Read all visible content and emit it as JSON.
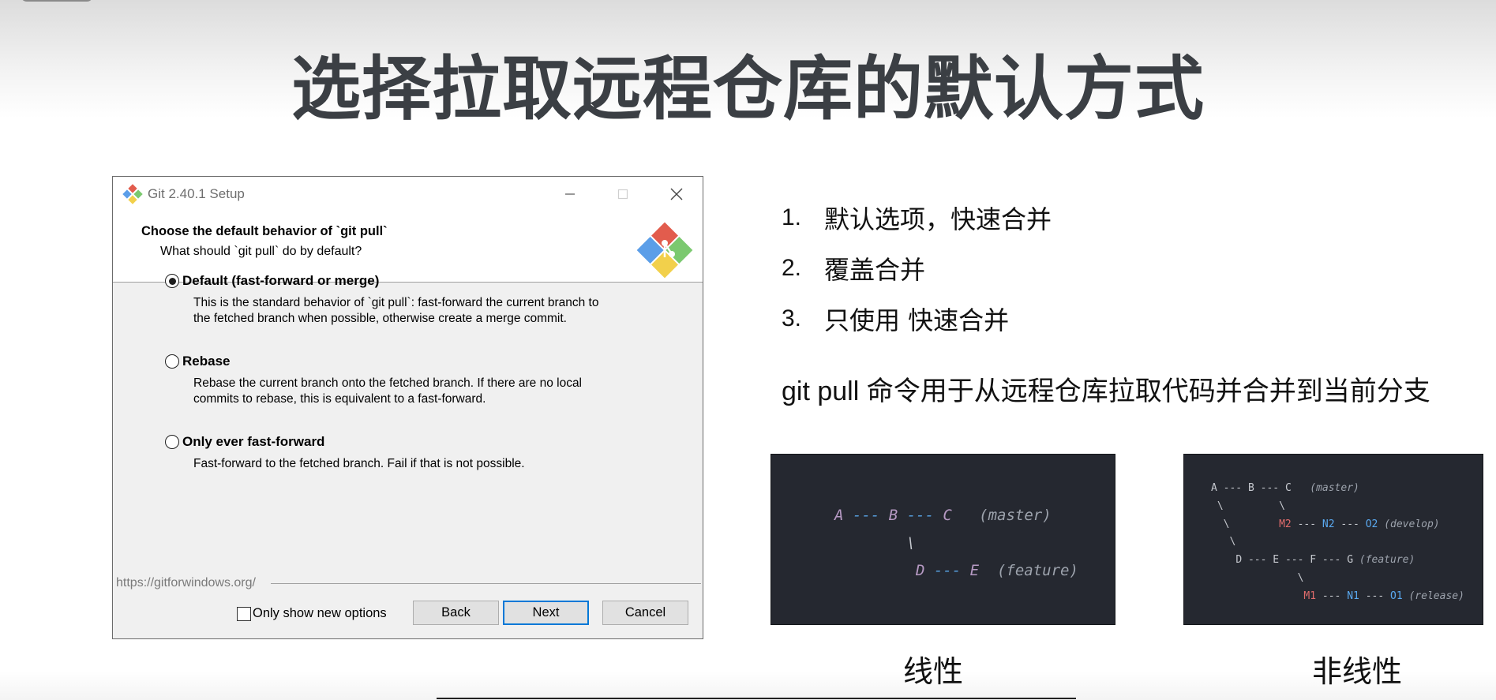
{
  "slide": {
    "title": "选择拉取远程仓库的默认方式"
  },
  "dialog": {
    "window_title": "Git 2.40.1 Setup",
    "header_title": "Choose the default behavior of `git pull`",
    "header_subtitle": "What should `git pull` do by default?",
    "options": [
      {
        "label": "Default (fast-forward or merge)",
        "description": "This is the standard behavior of `git pull`: fast-forward the current branch to\nthe fetched branch when possible, otherwise create a merge commit.",
        "selected": true
      },
      {
        "label": "Rebase",
        "description": "Rebase the current branch onto the fetched branch. If there are no local\ncommits to rebase, this is equivalent to a fast-forward.",
        "selected": false
      },
      {
        "label": "Only ever fast-forward",
        "description": "Fast-forward to the fetched branch. Fail if that is not possible.",
        "selected": false
      }
    ],
    "footer_url": "https://gitforwindows.org/",
    "only_new_options_label": "Only show new options",
    "buttons": {
      "back": "Back",
      "next": "Next",
      "cancel": "Cancel"
    },
    "icons": [
      "git-app-icon",
      "minimize-icon",
      "maximize-icon",
      "close-icon",
      "git-logo-icon"
    ]
  },
  "notes": {
    "points": [
      {
        "num": "1.",
        "text": "默认选项，快速合并"
      },
      {
        "num": "2.",
        "text": "覆盖合并"
      },
      {
        "num": "3.",
        "text": "只使用 快速合并"
      }
    ],
    "description": "git pull 命令用于从远程仓库拉取代码并合并到当前分支"
  },
  "diagrams": {
    "linear": {
      "line1": {
        "a": "A",
        "d1": "---",
        "b": "B",
        "d2": "---",
        "c": "C",
        "label": "(master)"
      },
      "line2": "\\",
      "line3": {
        "d": "D",
        "d1": "---",
        "e": "E",
        "label": "(feature)"
      },
      "caption": "线性"
    },
    "nonlinear": {
      "row1": {
        "a": "A",
        "b": "B",
        "c": "C",
        "dash": "---",
        "label": "(master)"
      },
      "row2": "\\         \\",
      "row3": {
        "m2": "M2",
        "n2": "N2",
        "o2": "O2",
        "dash": "---",
        "label": "(develop)"
      },
      "row4": "\\",
      "row5": {
        "d": "D",
        "e": "E",
        "f": "F",
        "g": "G",
        "dash": "---",
        "label": "(feature)"
      },
      "row6": "\\",
      "row7": {
        "m1": "M1",
        "n1": "N1",
        "o1": "O1",
        "dash": "---",
        "label": "(release)"
      },
      "caption": "非线性"
    }
  },
  "colors": {
    "title": "#3b3f44",
    "code_bg": "#252830",
    "node_purple": "#b79ac4",
    "dash_blue": "#56a0e0",
    "node_red": "#e06c6c",
    "node_blue": "#5aa9f0",
    "button_focus": "#0078d7"
  }
}
